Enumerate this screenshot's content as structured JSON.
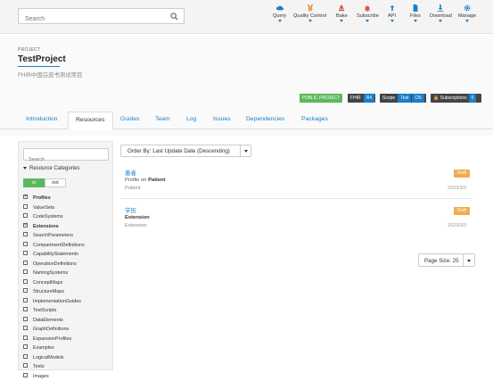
{
  "search": {
    "placeholder": "Search"
  },
  "nav": [
    {
      "label": "Query",
      "icon": "cloud-icon",
      "color": "#1a7ec8"
    },
    {
      "label": "Quality Control",
      "icon": "medal-icon",
      "color": "#e8a33c"
    },
    {
      "label": "Bake",
      "icon": "chef-icon",
      "color": "#d9534f"
    },
    {
      "label": "Subscribe",
      "icon": "bell-icon",
      "color": "#d9534f"
    },
    {
      "label": "API",
      "icon": "api-icon",
      "color": "#1a7ec8"
    },
    {
      "label": "Files",
      "icon": "file-icon",
      "color": "#1a7ec8"
    },
    {
      "label": "Download",
      "icon": "download-icon",
      "color": "#1a7ec8"
    },
    {
      "label": "Manage",
      "icon": "gear-icon",
      "color": "#1a7ec8"
    }
  ],
  "project": {
    "kicker": "PROJECT",
    "title": "TestProject",
    "description": "FHIR中国白皮书测试项目"
  },
  "badges": {
    "public": "PUBLIC PROJECT",
    "fhir_label": "FHIR",
    "fhir_value": "R4",
    "scope_label": "Scope",
    "scope_value1": "Test",
    "scope_value2": "CN",
    "subscriptions_label": "Subscriptions",
    "subscriptions_count": "0"
  },
  "tabs": [
    "Introduction",
    "Resources",
    "Guides",
    "Team",
    "Log",
    "Issues",
    "Dependencies",
    "Packages"
  ],
  "sidebar": {
    "search_placeholder": "Search",
    "categories_title": "Resource Categories",
    "toggle_or": "or",
    "toggle_not": "not",
    "items": [
      {
        "label": "Profiles",
        "checked": true
      },
      {
        "label": "ValueSets",
        "checked": false
      },
      {
        "label": "CodeSystems",
        "checked": false
      },
      {
        "label": "Extensions",
        "checked": true
      },
      {
        "label": "SearchParameters",
        "checked": false
      },
      {
        "label": "CompartmentDefinitions",
        "checked": false
      },
      {
        "label": "CapabilityStatements",
        "checked": false
      },
      {
        "label": "OperationDefinitions",
        "checked": false
      },
      {
        "label": "NamingSystems",
        "checked": false
      },
      {
        "label": "ConceptMaps",
        "checked": false
      },
      {
        "label": "StructureMaps",
        "checked": false
      },
      {
        "label": "ImplementationGuides",
        "checked": false
      },
      {
        "label": "TestScripts",
        "checked": false
      },
      {
        "label": "DataElements",
        "checked": false
      },
      {
        "label": "GraphDefinitions",
        "checked": false
      },
      {
        "label": "ExpansionProfiles",
        "checked": false
      },
      {
        "label": "Examples",
        "checked": false
      },
      {
        "label": "LogicalModels",
        "checked": false
      },
      {
        "label": "Texts",
        "checked": false
      },
      {
        "label": "Images",
        "checked": false
      }
    ]
  },
  "order_by": "Order By: Last Update Date (Descending)",
  "results": [
    {
      "name": "患者",
      "line_prefix": "Profile on",
      "line_bold": "Patient",
      "sub": "Patient",
      "status": "Draft",
      "date": "2023/3/3"
    },
    {
      "name": "学历",
      "line_prefix": "",
      "line_bold": "Extension",
      "sub": "Extension",
      "status": "Draft",
      "date": "2023/3/3"
    }
  ],
  "page_size": "Page Size: 25"
}
